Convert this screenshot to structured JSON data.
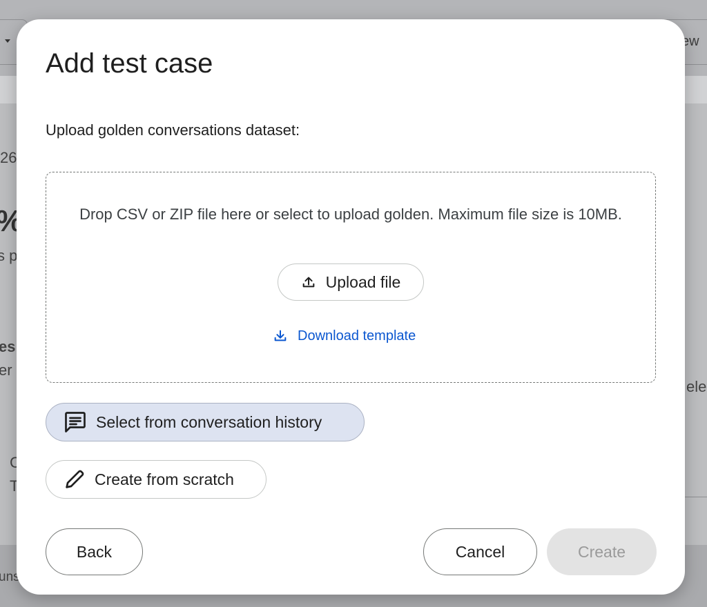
{
  "background": {
    "view_button_fragment": "ew",
    "fragments": [
      "26",
      "%",
      "s p",
      "es",
      "er",
      "C",
      "T",
      "ele",
      "uns"
    ]
  },
  "dialog": {
    "title": "Add test case",
    "subtitle": "Upload golden conversations dataset:",
    "dropzone": {
      "text": "Drop CSV or ZIP file here or select to upload golden. Maximum file size is 10MB.",
      "upload_label": "Upload file",
      "upload_icon": "upload-icon",
      "download_label": "Download template",
      "download_icon": "download-icon"
    },
    "options": {
      "history_label": "Select from conversation history",
      "history_icon": "chat-message-icon",
      "scratch_label": "Create from scratch",
      "scratch_icon": "pencil-icon"
    },
    "footer": {
      "back_label": "Back",
      "cancel_label": "Cancel",
      "create_label": "Create",
      "create_disabled": true
    }
  },
  "colors": {
    "link": "#0b57d0",
    "history_bg": "#dde3f1",
    "disabled_bg": "#e3e3e3",
    "disabled_text": "#9a9a9a"
  }
}
